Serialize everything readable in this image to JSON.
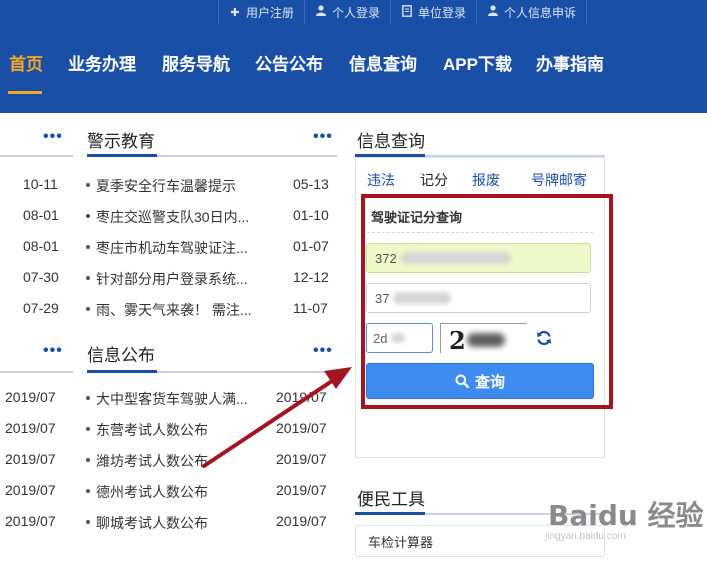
{
  "top_links": [
    {
      "icon": "plus-icon",
      "label": "用户注册"
    },
    {
      "icon": "user-icon",
      "label": "个人登录"
    },
    {
      "icon": "document-icon",
      "label": "单位登录"
    },
    {
      "icon": "user-icon",
      "label": "个人信息申诉"
    }
  ],
  "nav": [
    "首页",
    "业务办理",
    "服务导航",
    "公告公布",
    "信息查询",
    "APP下载",
    "办事指南"
  ],
  "more_label": "•••",
  "left_dates_top": [
    "10-11",
    "08-01",
    "08-01",
    "07-30",
    "07-29"
  ],
  "warning": {
    "title": "警示教育",
    "items": [
      {
        "text": "夏季安全行车温馨提示",
        "date": "05-13"
      },
      {
        "text": "枣庄交巡警支队30日内...",
        "date": "01-10"
      },
      {
        "text": "枣庄市机动车驾驶证注...",
        "date": "01-07"
      },
      {
        "text": "针对部分用户登录系统...",
        "date": "12-12"
      },
      {
        "text": "雨、雾天气来袭！ 需注...",
        "date": "11-07"
      }
    ]
  },
  "left_dates_bottom": [
    "2019/07",
    "2019/07",
    "2019/07",
    "2019/07",
    "2019/07"
  ],
  "notice": {
    "title": "信息公布",
    "items": [
      {
        "text": "大中型客货车驾驶人满...",
        "date": "2019/07"
      },
      {
        "text": "东营考试人数公布",
        "date": "2019/07"
      },
      {
        "text": "潍坊考试人数公布",
        "date": "2019/07"
      },
      {
        "text": "德州考试人数公布",
        "date": "2019/07"
      },
      {
        "text": "聊城考试人数公布",
        "date": "2019/07"
      }
    ]
  },
  "query": {
    "title": "信息查询",
    "tabs": [
      "违法",
      "记分",
      "报废",
      "号牌邮寄"
    ],
    "active_tab": "记分",
    "form_title": "驾驶证记分查询",
    "field1_value": "372",
    "field2_value": "37",
    "captcha_value": "2d",
    "captcha_text": "2",
    "submit_label": "查询"
  },
  "tools": {
    "title": "便民工具",
    "item": "车检计算器"
  },
  "watermark": {
    "brand": "Baidu 经验",
    "url": "jingyan.baidu.com"
  },
  "colors": {
    "brand_blue": "#1a4fa8",
    "nav_active": "#f5a623",
    "button_blue": "#3f8cf0",
    "highlight_red": "#a31520"
  }
}
